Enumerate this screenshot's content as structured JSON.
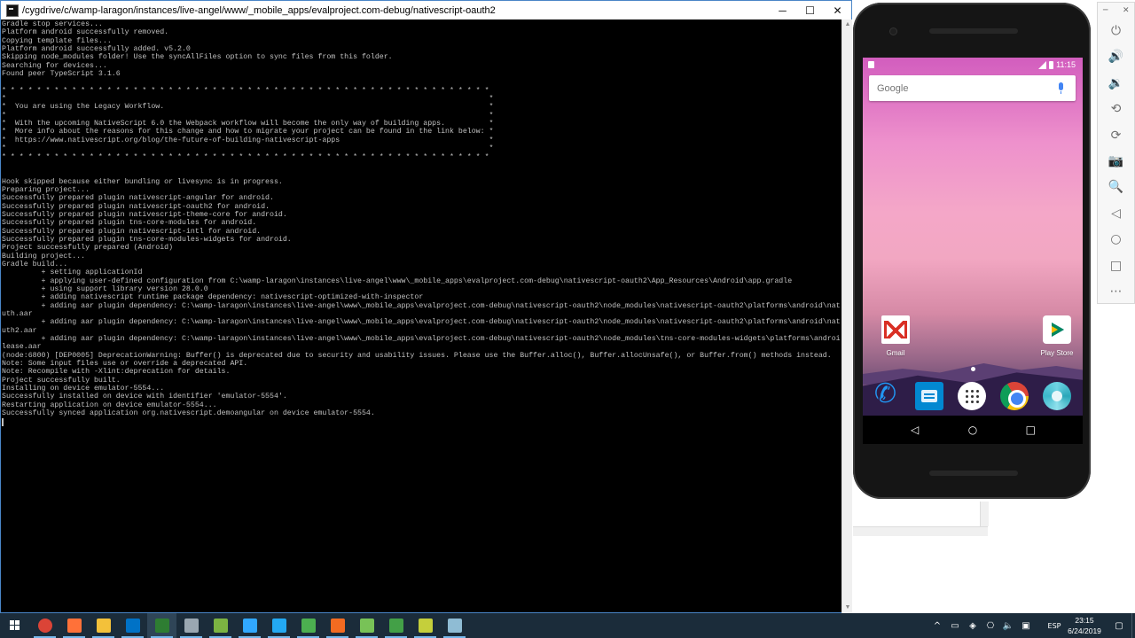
{
  "terminal": {
    "title": "/cygdrive/c/wamp-laragon/instances/live-angel/www/_mobile_apps/evalproject.com-debug/nativescript-oauth2",
    "lines": [
      "Gradle stop services...",
      "Platform android successfully removed.",
      "Copying template files...",
      "Platform android successfully added. v5.2.0",
      "Skipping node_modules folder! Use the syncAllFiles option to sync files from this folder.",
      "Searching for devices...",
      "Found peer TypeScript 3.1.6",
      "",
      "* * * * * * * * * * * * * * * * * * * * * * * * * * * * * * * * * * * * * * * * * * * * * * * * * * * * * * * *",
      "*                                                                                                              *",
      "*  You are using the Legacy Workflow.                                                                          *",
      "*                                                                                                              *",
      "*  With the upcoming NativeScript 6.0 the Webpack workflow will become the only way of building apps.          *",
      "*  More info about the reasons for this change and how to migrate your project can be found in the link below: *",
      "*  https://www.nativescript.org/blog/the-future-of-building-nativescript-apps                                  *",
      "*                                                                                                              *",
      "* * * * * * * * * * * * * * * * * * * * * * * * * * * * * * * * * * * * * * * * * * * * * * * * * * * * * * * *",
      "",
      "",
      "Hook skipped because either bundling or livesync is in progress.",
      "Preparing project...",
      "Successfully prepared plugin nativescript-angular for android.",
      "Successfully prepared plugin nativescript-oauth2 for android.",
      "Successfully prepared plugin nativescript-theme-core for android.",
      "Successfully prepared plugin tns-core-modules for android.",
      "Successfully prepared plugin nativescript-intl for android.",
      "Successfully prepared plugin tns-core-modules-widgets for android.",
      "Project successfully prepared (Android)",
      "Building project...",
      "Gradle build...",
      "         + setting applicationId",
      "         + applying user-defined configuration from C:\\wamp-laragon\\instances\\live-angel\\www\\_mobile_apps\\evalproject.com-debug\\nativescript-oauth2\\App_Resources\\Android\\app.gradle",
      "         + using support library version 28.0.0",
      "         + adding nativescript runtime package dependency: nativescript-optimized-with-inspector",
      "         + adding aar plugin dependency: C:\\wamp-laragon\\instances\\live-angel\\www\\_mobile_apps\\evalproject.com-debug\\nativescript-oauth2\\node_modules\\nativescript-oauth2\\platforms\\android\\nativescript_oa",
      "uth.aar",
      "         + adding aar plugin dependency: C:\\wamp-laragon\\instances\\live-angel\\www\\_mobile_apps\\evalproject.com-debug\\nativescript-oauth2\\node_modules\\nativescript-oauth2\\platforms\\android\\nativescript_oa",
      "uth2.aar",
      "         + adding aar plugin dependency: C:\\wamp-laragon\\instances\\live-angel\\www\\_mobile_apps\\evalproject.com-debug\\nativescript-oauth2\\node_modules\\tns-core-modules-widgets\\platforms\\android\\widgets-re",
      "lease.aar",
      "(node:6800) [DEP0005] DeprecationWarning: Buffer() is deprecated due to security and usability issues. Please use the Buffer.alloc(), Buffer.allocUnsafe(), or Buffer.from() methods instead.",
      "Note: Some input files use or override a deprecated API.",
      "Note: Recompile with -Xlint:deprecation for details.",
      "Project successfully built.",
      "Installing on device emulator-5554...",
      "Successfully installed on device with identifier 'emulator-5554'.",
      "Restarting application on device emulator-5554...",
      "Successfully synced application org.nativescript.demoangular on device emulator-5554."
    ]
  },
  "window_controls": {
    "minimize": "─",
    "maximize": "☐",
    "close": "✕"
  },
  "phone": {
    "status_time": "11:15",
    "search_logo": "Google",
    "apps": {
      "gmail": "Gmail",
      "play_store": "Play Store"
    },
    "nav": {
      "back": "◁",
      "home": "○",
      "recents": "□"
    }
  },
  "emulator_toolbar": {
    "close": "✕",
    "minimize": "─",
    "buttons": [
      "power",
      "volume-up",
      "volume-down",
      "rotate-left",
      "rotate-right",
      "screenshot",
      "zoom",
      "back",
      "home",
      "overview",
      "more"
    ],
    "glyphs": {
      "power": "⏻",
      "volume-up": "🔊",
      "volume-down": "🔉",
      "rotate-left": "⟲",
      "rotate-right": "⟳",
      "screenshot": "📷",
      "zoom": "🔍",
      "back": "◁",
      "home": "○",
      "overview": "□",
      "more": "⋯"
    }
  },
  "taskbar": {
    "tray_language": "ESP",
    "time": "23:15",
    "date": "6/24/2019",
    "apps": [
      {
        "name": "chrome",
        "color": "#db4437",
        "running": true
      },
      {
        "name": "firefox",
        "color": "#ff7139",
        "running": true
      },
      {
        "name": "file-explorer",
        "color": "#f3c13a",
        "running": true
      },
      {
        "name": "outlook",
        "color": "#0072c6",
        "running": true
      },
      {
        "name": "terminal",
        "color": "#2e7d32",
        "running": true,
        "active": true
      },
      {
        "name": "app-6",
        "color": "#9aa7b1",
        "running": true
      },
      {
        "name": "app-7",
        "color": "#7cb342",
        "running": true
      },
      {
        "name": "photoshop",
        "color": "#31a8ff",
        "running": true
      },
      {
        "name": "vscode",
        "color": "#23a9f2",
        "running": true
      },
      {
        "name": "app-10",
        "color": "#4caf50",
        "running": true
      },
      {
        "name": "app-11",
        "color": "#f36b21",
        "running": true
      },
      {
        "name": "android-studio",
        "color": "#78c257",
        "running": true
      },
      {
        "name": "app-13",
        "color": "#43a047",
        "running": true
      },
      {
        "name": "app-14",
        "color": "#c5cf3b",
        "running": true
      },
      {
        "name": "app-15",
        "color": "#8fbcd4",
        "running": true
      }
    ]
  }
}
